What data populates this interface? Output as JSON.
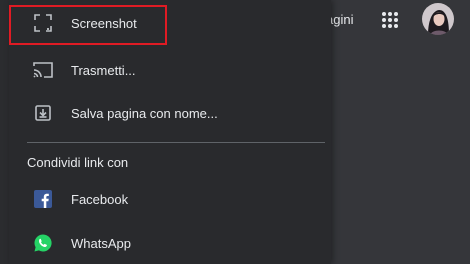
{
  "menu": {
    "items": [
      {
        "label": "Screenshot",
        "icon": "screenshot-icon"
      },
      {
        "label": "Trasmetti...",
        "icon": "cast-icon"
      },
      {
        "label": "Salva pagina con nome...",
        "icon": "download-icon"
      }
    ],
    "share_heading": "Condividi link con",
    "share_items": [
      {
        "label": "Facebook",
        "icon": "facebook-icon"
      },
      {
        "label": "WhatsApp",
        "icon": "whatsapp-icon"
      }
    ]
  },
  "background": {
    "partial_text": "agini"
  },
  "colors": {
    "menu_bg": "#292a2d",
    "page_bg": "#35363a",
    "text": "#e8eaed",
    "icon": "#bdc1c6",
    "highlight": "#e01b24",
    "facebook": "#3b5998",
    "whatsapp": "#25d366"
  }
}
